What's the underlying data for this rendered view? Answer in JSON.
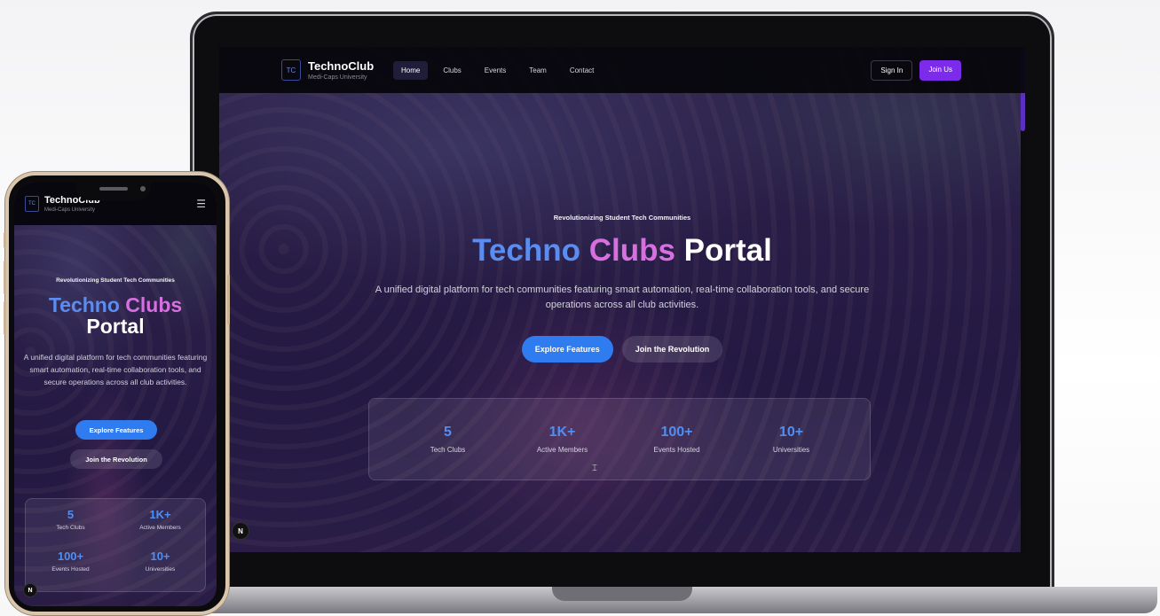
{
  "brand": {
    "logo_text": "TC",
    "name": "TechnoClub",
    "subtitle": "Medi-Caps University"
  },
  "nav": {
    "links": [
      "Home",
      "Clubs",
      "Events",
      "Team",
      "Contact"
    ],
    "active": "Home",
    "sign_in": "Sign In",
    "join": "Join Us"
  },
  "hero": {
    "tagline": "Revolutionizing Student Tech Communities",
    "title_part1": "Techno",
    "title_part2": "Clubs",
    "title_part3": "Portal",
    "description": "A unified digital platform for tech communities featuring smart automation, real-time collaboration tools, and secure operations across all club activities.",
    "btn_primary": "Explore Features",
    "btn_secondary": "Join the Revolution"
  },
  "stats": [
    {
      "value": "5",
      "label": "Tech Clubs"
    },
    {
      "value": "1K+",
      "label": "Active Members"
    },
    {
      "value": "100+",
      "label": "Events Hosted"
    },
    {
      "value": "10+",
      "label": "Universities"
    }
  ],
  "badge": "N",
  "icons": {
    "menu": "hamburger-menu-icon",
    "cursor": "text-cursor-icon"
  },
  "colors": {
    "accent_blue": "#2f7cf0",
    "accent_purple": "#7c2bea",
    "title_pink": "#d66fe0",
    "stat_blue": "#4f8ff5"
  }
}
